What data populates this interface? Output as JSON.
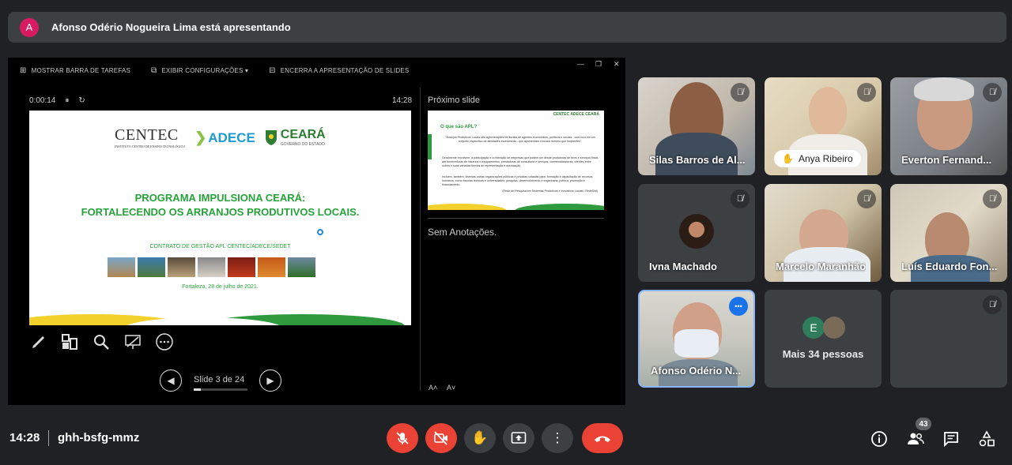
{
  "presenter": {
    "avatar_letter": "A",
    "text": "Afonso Odério Nogueira Lima está apresentando"
  },
  "presenter_view": {
    "toolbar": {
      "taskbar": "MOSTRAR BARRA DE TAREFAS",
      "settings": "EXIBIR CONFIGURAÇÕES ▾",
      "end_show": "ENCERRA A APRESENTAÇÃO DE SLIDES"
    },
    "window_controls": {
      "minimize": "—",
      "restore": "❐",
      "close": "✕"
    },
    "timer": "0:00:14",
    "pause_icon": "⏸",
    "reset_icon": "↻",
    "clock": "14:28",
    "next_slide_label": "Próximo slide",
    "notes": "Sem Anotações.",
    "slide_counter": "Slide 3 de 24",
    "slide_progress": 0.125,
    "font_increase": "A˄",
    "font_decrease": "A˅"
  },
  "current_slide": {
    "logo_centec": "CENTEC",
    "logo_centec_sub": "INSTITUTO CENTRO DE ENSINO TECNOLÓGICO",
    "logo_adece": "ADECE",
    "logo_ceara": "CEARÁ",
    "logo_ceara_sub": "GOVERNO DO ESTADO",
    "title_line1": "PROGRAMA IMPULSIONA CEARÁ:",
    "title_line2": "FORTALECENDO OS ARRANJOS PRODUTIVOS LOCAIS.",
    "contract": "CONTRATO DE GESTÃO  APL CENTEC/ADECE/SEDET",
    "date": "Fortaleza, 28 de julho de 2021."
  },
  "next_slide": {
    "header_logos": "CENTEC  ADECE  CEARÁ",
    "question": "O que são APL?",
    "body1": "\"Arranjos Produtivos Locais são aglomerações territoriais de agentes econômicos, políticos e sociais - com foco em um conjunto específico de atividades econômicas - que apresentam vínculos mesmo que incipientes\".",
    "body2": "Geralmente envolvem: a participação e a interação de empresas que podem ser desde produtoras de bens e serviços finais até fornecedoras de insumos e equipamentos, prestadoras de consultoria e serviços, comercializadoras, clientes entre outros e suas variadas formas de representação e associação.",
    "body3": "Incluem, também, diversas outras organizações públicas e privadas voltadas para: formação e capacitação de recursos humanos, como escolas técnicas e universidades; pesquisa, desenvolvimento e engenharia; política, promoção e financiamento.",
    "source": "(Rede de Pesquisa em Sistemas Produtivos e Inovativos Locais / RedeSist)"
  },
  "participants": [
    {
      "name": "Silas Barros de Al...",
      "muted": true
    },
    {
      "name": "Anya Ribeiro",
      "muted": true,
      "hand_raised": true
    },
    {
      "name": "Everton Fernand...",
      "muted": true
    },
    {
      "name": "Ivna Machado",
      "muted": true
    },
    {
      "name": "Marcelo Maranhão",
      "muted": true
    },
    {
      "name": "Luís Eduardo Fon...",
      "muted": true
    },
    {
      "name": "Afonso Odério N...",
      "muted": false,
      "more_icon": "•••"
    },
    {
      "name": "Mais 34 pessoas",
      "avatar_letter": "E"
    },
    {
      "name": "",
      "muted": true
    }
  ],
  "bottom": {
    "time": "14:28",
    "meeting_code": "ghh-bsfg-mmz",
    "people_count": "43",
    "icons": [
      "mic-off-icon",
      "camera-off-icon",
      "raise-hand-icon",
      "present-screen-icon",
      "more-options-icon",
      "end-call-icon",
      "info-icon",
      "people-icon",
      "chat-icon",
      "activities-icon"
    ]
  },
  "colors": {
    "background": "#202124",
    "end_call": "#ea4335",
    "slide_green": "#27a23a",
    "adece_blue": "#1e9ad6"
  }
}
